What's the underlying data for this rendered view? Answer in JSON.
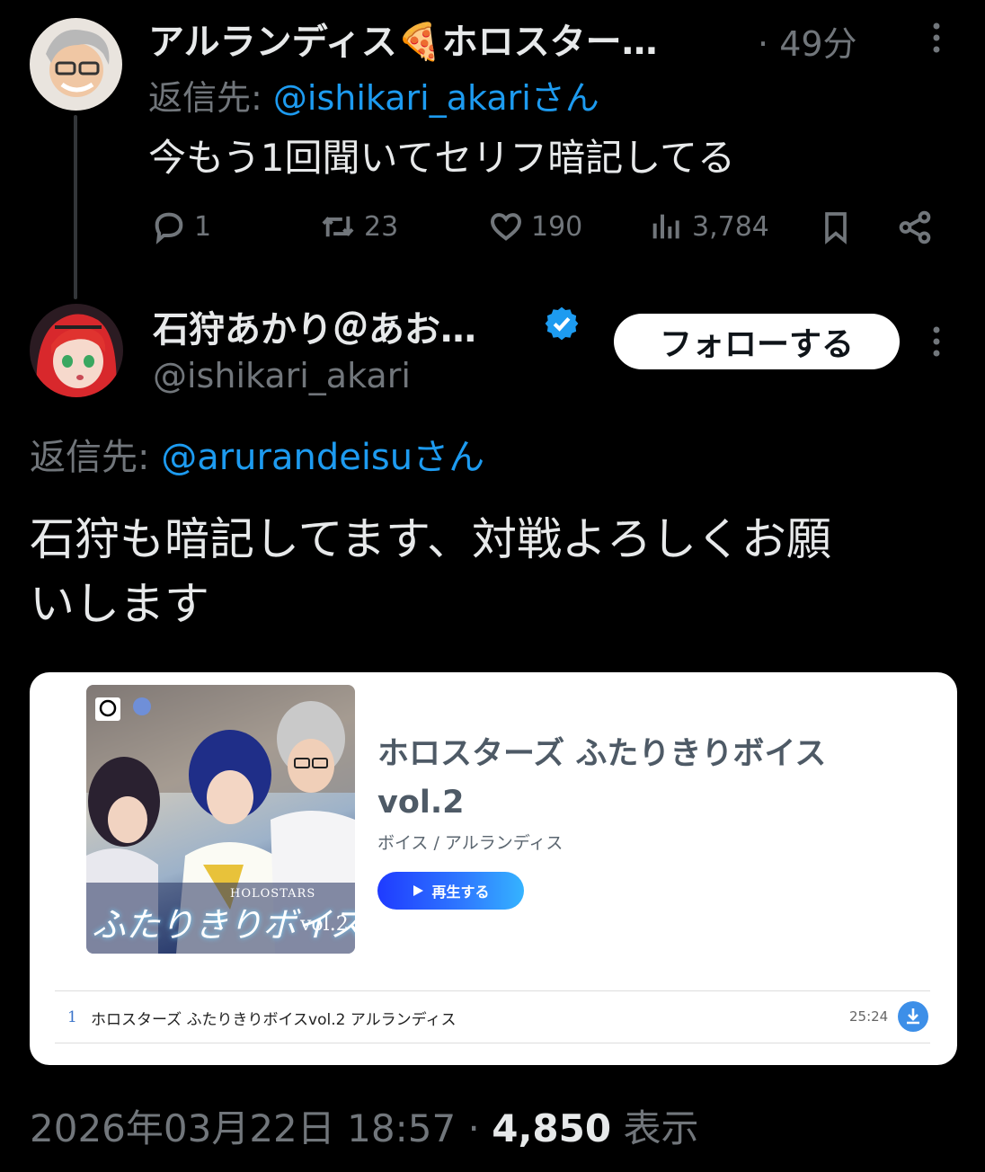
{
  "tweet1": {
    "display_name": "アルランディス🍕ホロスター…",
    "time": "49分",
    "reply_label": "返信先: ",
    "reply_handle": "@ishikari_akari",
    "reply_suffix": "さん",
    "text": "今もう1回聞いてセリフ暗記してる",
    "replies": "1",
    "retweets": "23",
    "likes": "190",
    "views": "3,784"
  },
  "tweet2": {
    "display_name": "石狩あかり＠あお…",
    "handle": "@ishikari_akari",
    "follow_label": "フォローする",
    "reply_label": "返信先: ",
    "reply_handle": "@arurandeisu",
    "reply_suffix": "さん",
    "text_line1": "石狩も暗記してます、対戦よろしくお願",
    "text_line2": "いします"
  },
  "card": {
    "title": "ホロスターズ ふたりきりボイス vol.2",
    "subtitle": "ボイス / アルランディス",
    "play_label": "再生する",
    "cover_text": "ふたりきりボイス",
    "cover_vol": "vol.2",
    "cover_brand": "HOLOSTARS",
    "track_number": "1",
    "track_title": "ホロスターズ ふたりきりボイスvol.2 アルランディス",
    "track_duration": "25:24"
  },
  "footer": {
    "timestamp": "2026年03月22日 18:57",
    "separator": " · ",
    "views": "4,850",
    "views_label": " 表示"
  },
  "colors": {
    "background": "#000000",
    "link": "#1d9bf0",
    "muted": "#71767b",
    "verified": "#1d9bf0"
  }
}
